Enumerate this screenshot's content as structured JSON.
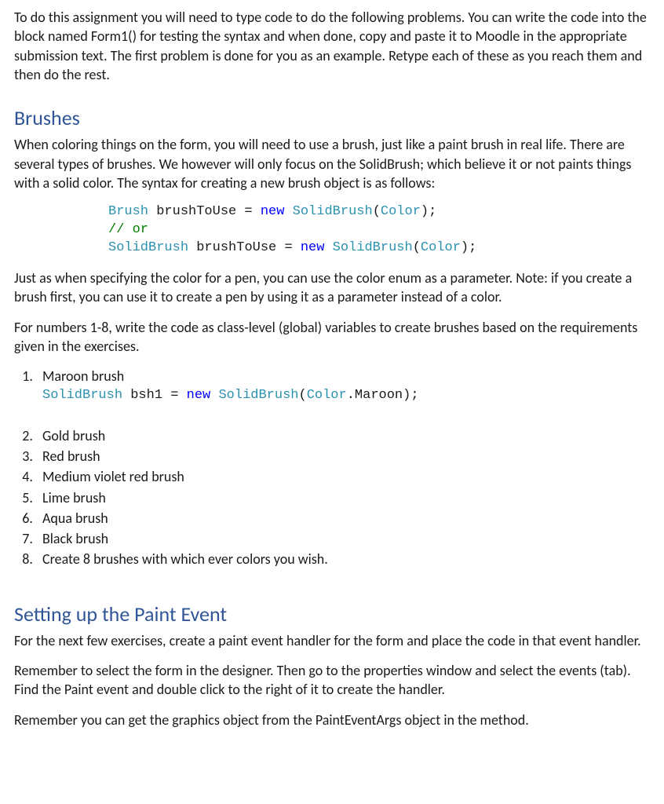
{
  "intro": "To do this assignment you will need to type code to do the following problems. You can write the code into the block named Form1() for testing the syntax and when done, copy and paste it to Moodle in the appropriate submission text. The first problem is done for you as an example. Retype each of these as you reach them and then do the rest.",
  "section1": {
    "heading": "Brushes",
    "para1": "When coloring things on the form, you will need to use a brush, just like a paint brush in real life. There are several types of brushes. We however will only focus on the SolidBrush; which believe it or not paints things with a solid color.  The syntax for creating a new brush object is as follows:",
    "code": {
      "line1": {
        "t1": "Brush",
        "t2": " brushToUse = ",
        "t3": "new",
        "t4": " ",
        "t5": "SolidBrush",
        "t6": "(",
        "t7": "Color",
        "t8": ");"
      },
      "line2": {
        "t1": "// or"
      },
      "line3": {
        "t1": "SolidBrush",
        "t2": " brushToUse = ",
        "t3": "new",
        "t4": " ",
        "t5": "SolidBrush",
        "t6": "(",
        "t7": "Color",
        "t8": ");"
      }
    },
    "para2": "Just as when specifying the color for a pen, you can use the color enum as a parameter. Note: if you create a brush first, you can use it to create a pen by using it as a parameter instead of a color.",
    "para3": "For numbers 1-8, write the code as class-level (global) variables to create brushes based on the requirements given in the exercises.",
    "items": {
      "i1": {
        "label": "Maroon brush",
        "code": {
          "t1": "SolidBrush",
          "t2": " bsh1 = ",
          "t3": "new",
          "t4": " ",
          "t5": "SolidBrush",
          "t6": "(",
          "t7": "Color",
          "t8": ".Maroon);"
        }
      },
      "i2": "Gold brush",
      "i3": "Red brush",
      "i4": "Medium violet red brush",
      "i5": "Lime brush",
      "i6": "Aqua brush",
      "i7": "Black brush",
      "i8": "Create 8 brushes with which ever colors you wish."
    }
  },
  "section2": {
    "heading": "Setting up the Paint Event",
    "para1": "For the next few exercises, create a paint event handler for the form and place the code in that event handler.",
    "para2": "Remember to select the form in the designer. Then go to the properties window and select the events (tab). Find the Paint event and double click to the right of it to create the handler.",
    "para3": "Remember you can get the graphics object from the PaintEventArgs object in the method."
  }
}
